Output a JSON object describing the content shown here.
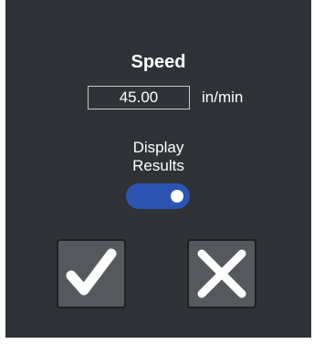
{
  "speed": {
    "title": "Speed",
    "value": "45.00",
    "unit": "in/min"
  },
  "display_results": {
    "label_line1": "Display",
    "label_line2": "Results",
    "enabled": true
  },
  "buttons": {
    "confirm_icon": "checkmark-icon",
    "cancel_icon": "close-x-icon"
  },
  "colors": {
    "background": "#2f3237",
    "toggle_on": "#2c54b3",
    "button_face": "#55585d",
    "text": "#ffffff"
  }
}
